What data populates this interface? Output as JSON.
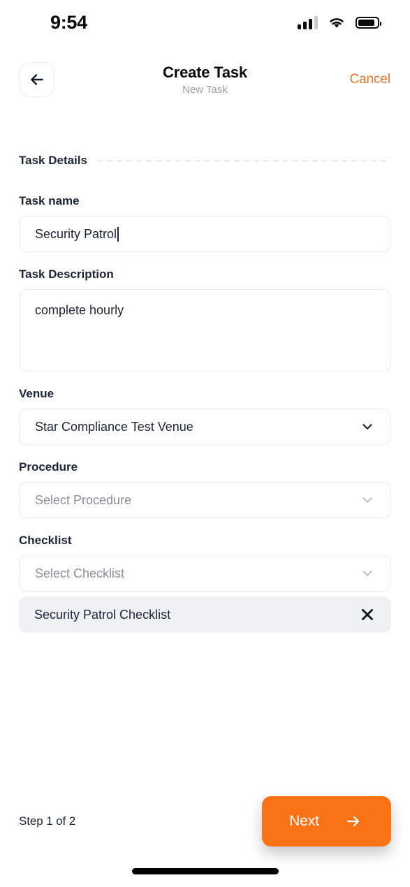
{
  "status_bar": {
    "time": "9:54",
    "cellular_icon": "cellular-signal-icon",
    "wifi_icon": "wifi-icon",
    "battery_icon": "battery-icon"
  },
  "header": {
    "back_icon": "arrow-left-icon",
    "title": "Create Task",
    "subtitle": "New Task",
    "cancel_label": "Cancel",
    "cancel_color": "#e8742c"
  },
  "section": {
    "label": "Task Details"
  },
  "fields": {
    "task_name": {
      "label": "Task name",
      "value": "Security Patrol",
      "placeholder": "Task name"
    },
    "task_description": {
      "label": "Task Description",
      "value": "complete hourly",
      "placeholder": "Task Description"
    },
    "venue": {
      "label": "Venue",
      "value": "Star Compliance Test Venue",
      "placeholder": "Select Venue",
      "chevron_icon": "chevron-down-icon"
    },
    "procedure": {
      "label": "Procedure",
      "value": "Select Procedure",
      "placeholder": "Select Procedure",
      "chevron_icon": "chevron-down-icon"
    },
    "checklist": {
      "label": "Checklist",
      "value": "Select Checklist",
      "placeholder": "Select Checklist",
      "chevron_icon": "chevron-down-icon",
      "selected": {
        "label": "Security Patrol Checklist",
        "remove_icon": "close-icon"
      }
    }
  },
  "footer": {
    "step_text": "Step 1 of 2",
    "next_label": "Next",
    "next_icon": "arrow-right-icon",
    "next_color": "#f97316"
  }
}
